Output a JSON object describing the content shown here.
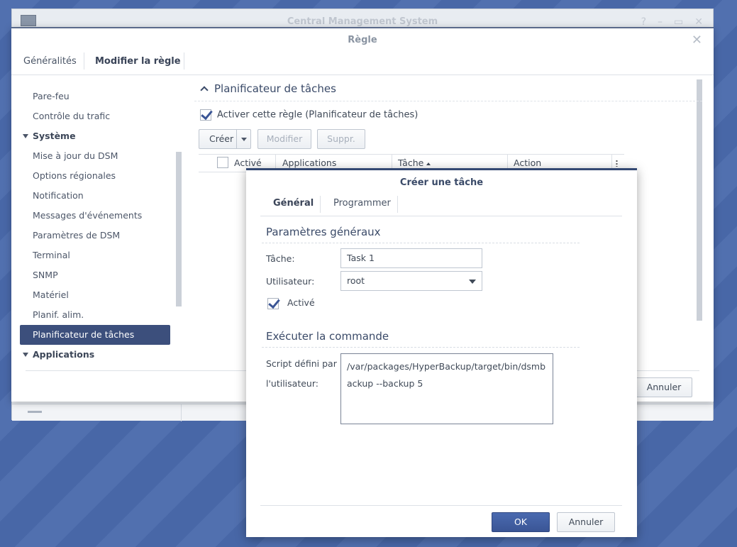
{
  "cms": {
    "title": "Central Management System",
    "controls": [
      "?",
      "–",
      "▭",
      "✕"
    ]
  },
  "rule": {
    "title": "Règle",
    "close": "✕",
    "tabs": [
      "Généralités",
      "Modifier la règle"
    ],
    "sidebar": [
      {
        "label": "Pare-feu",
        "type": "item"
      },
      {
        "label": "Contrôle du trafic",
        "type": "item"
      },
      {
        "label": "Système",
        "type": "head"
      },
      {
        "label": "Mise à jour du DSM",
        "type": "item"
      },
      {
        "label": "Options régionales",
        "type": "item"
      },
      {
        "label": "Notification",
        "type": "item"
      },
      {
        "label": "Messages d'événements",
        "type": "item"
      },
      {
        "label": "Paramètres de DSM",
        "type": "item"
      },
      {
        "label": "Terminal",
        "type": "item"
      },
      {
        "label": "SNMP",
        "type": "item"
      },
      {
        "label": "Matériel",
        "type": "item"
      },
      {
        "label": "Planif. alim.",
        "type": "item"
      },
      {
        "label": "Planificateur de tâches",
        "type": "selected"
      },
      {
        "label": "Applications",
        "type": "head"
      }
    ],
    "section_title": "Planificateur de tâches",
    "enable_label": "Activer cette règle (Planificateur de tâches)",
    "toolbar": {
      "create": "Créer",
      "modify": "Modifier",
      "delete": "Suppr."
    },
    "grid_columns": [
      "Activé",
      "Applications",
      "Tâche",
      "Action"
    ],
    "cancel": "Annuler"
  },
  "task": {
    "title": "Créer une tâche",
    "tabs": [
      "Général",
      "Programmer"
    ],
    "general_section": "Paramètres généraux",
    "task_label": "Tâche:",
    "task_value": "Task 1",
    "user_label": "Utilisateur:",
    "user_value": "root",
    "enabled_label": "Activé",
    "command_section": "Exécuter la commande",
    "script_label_1": "Script défini par",
    "script_label_2": "l'utilisateur:",
    "script_value": "/var/packages/HyperBackup/target/bin/dsmbackup --backup 5",
    "ok": "OK",
    "cancel": "Annuler"
  },
  "colors": {
    "accent": "#3a5595",
    "selected": "#3c4f7c",
    "desktop": "#4a6aac"
  }
}
